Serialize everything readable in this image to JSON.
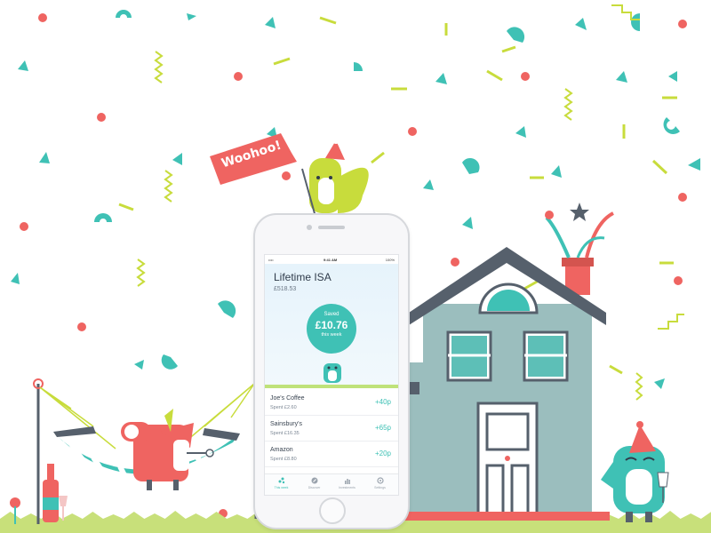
{
  "banner": {
    "text": "Woohoo!"
  },
  "phone": {
    "status_bar": {
      "carrier": "•••• ",
      "time": "9:41 AM",
      "battery": "100%"
    },
    "account": {
      "title": "Lifetime ISA",
      "balance": "£518.53"
    },
    "saved": {
      "label": "Saved",
      "amount": "£10.76",
      "period": "this week"
    },
    "transactions": [
      {
        "merchant": "Joe's Coffee",
        "spent": "Spent £2.60",
        "amount": "+40p"
      },
      {
        "merchant": "Sainsbury's",
        "spent": "Spent £16.35",
        "amount": "+65p"
      },
      {
        "merchant": "Amazon",
        "spent": "Spent £8.80",
        "amount": "+20p"
      }
    ],
    "tabs": [
      {
        "label": "This week",
        "icon": "dots-icon",
        "active": true
      },
      {
        "label": "Discover",
        "icon": "compass-icon",
        "active": false
      },
      {
        "label": "Investments",
        "icon": "bar-chart-icon",
        "active": false
      },
      {
        "label": "Settings",
        "icon": "gear-icon",
        "active": false
      }
    ]
  },
  "colors": {
    "teal": "#3fc1b5",
    "coral": "#ef6461",
    "lime": "#c8dc3c",
    "slate": "#56606c",
    "house": "#9bbebe"
  }
}
